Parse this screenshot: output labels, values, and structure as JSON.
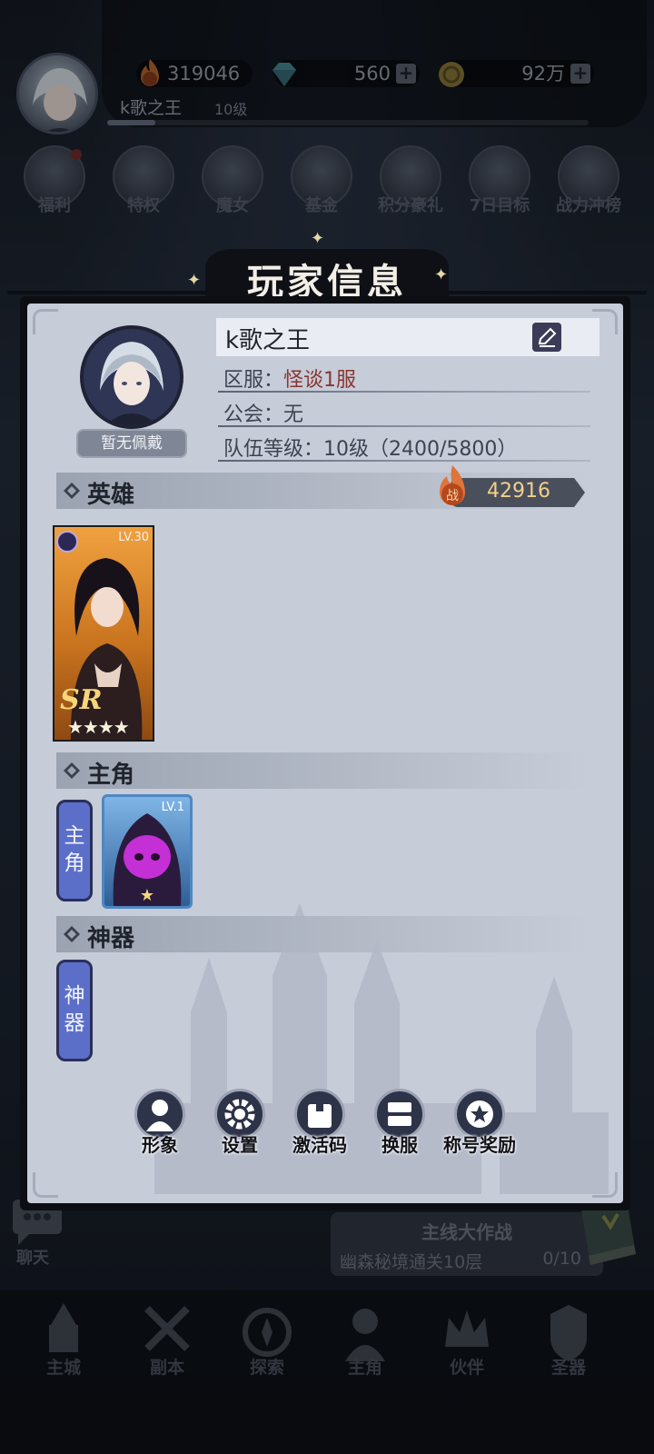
{
  "top_bar": {
    "power": "319046",
    "gems": "560",
    "gold": "92万",
    "player_name": "k歌之王",
    "player_level": "10级"
  },
  "features": [
    {
      "label": "福利",
      "icon": "gift-icon"
    },
    {
      "label": "特权",
      "icon": "gem-icon"
    },
    {
      "label": "魔女",
      "icon": "witch-icon"
    },
    {
      "label": "基金",
      "icon": "chest-icon"
    },
    {
      "label": "积分豪礼",
      "icon": "flower-icon"
    },
    {
      "label": "7日目标",
      "icon": "seven-icon"
    },
    {
      "label": "战力冲榜",
      "icon": "wings-icon"
    }
  ],
  "dialog": {
    "title": "玩家信息",
    "badge_button": "暂无佩戴",
    "name": "k歌之王",
    "server_label": "区服：",
    "server_value": "怪谈1服",
    "guild": "公会：无",
    "team_level": "队伍等级：10级（2400/5800）",
    "sections": {
      "heroes": "英雄",
      "lead": "主角",
      "artifact": "神器"
    },
    "hero_power": "42916",
    "hero_card": {
      "level": "LV.30",
      "rarity": "SR",
      "stars": "★★★★"
    },
    "lead_tag": [
      "主",
      "角"
    ],
    "lead_card": {
      "level": "LV.1",
      "stars": "★"
    },
    "artifact_tag": [
      "神",
      "器"
    ],
    "buttons": [
      "形象",
      "设置",
      "激活码",
      "换服",
      "称号奖励"
    ]
  },
  "chat": {
    "label": "聊天"
  },
  "quest": {
    "title": "主线大作战",
    "text": "幽森秘境通关10层",
    "progress": "0/10"
  },
  "bottom_nav": [
    "主城",
    "副本",
    "探索",
    "主角",
    "伙伴",
    "圣器"
  ],
  "colors": {
    "dialog_bg": "#c6ccd8",
    "accent_red": "#8a3530",
    "power_gold": "#f1d08a",
    "tag_blue": "#5c6fc8"
  }
}
